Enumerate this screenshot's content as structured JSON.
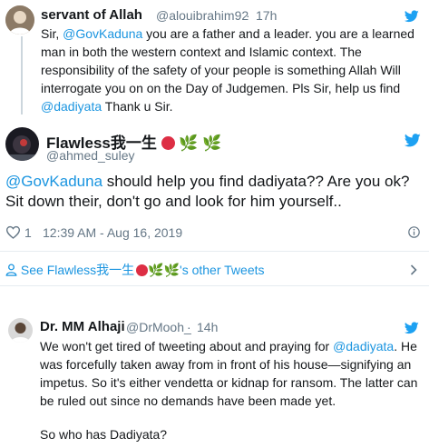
{
  "tweet1": {
    "name": "servant of Allah",
    "handle": "@alouibrahim92",
    "time": "17h",
    "text_pre": "Sir, ",
    "mention1": "@GovKaduna",
    "text_mid": " you are a father and a leader. you are a learned man in both the western context and Islamic context. The responsibility of the safety of your people is something Allah Will interrogate you on on the Day of Judgemen. Pls Sir, help us find ",
    "mention2": "@dadiyata",
    "text_post": " Thank u Sir."
  },
  "main_tweet": {
    "name": "Flawless我一生",
    "handle": "@ahmed_suley",
    "mention": "@GovKaduna",
    "text": " should help you find dadiyata?? Are you ok? Sit down their, don't go and look for him yourself..",
    "likes": "1",
    "timestamp": "12:39 AM - Aug 16, 2019"
  },
  "see_other": {
    "prefix": "See Flawless我一生",
    "suffix": "'s other Tweets"
  },
  "tweet3": {
    "name": "Dr. MM Alhaji",
    "handle": "@DrMooh_",
    "time": "14h",
    "text_pre": "We won't get tired of tweeting about and praying for ",
    "mention": "@dadiyata",
    "text_post": ". He was forcefully taken away from in front of his house—signifying an impetus. So it's either vendetta or kidnap for ransom. The latter can be ruled out since no demands have been made yet.",
    "text2": "So who has Dadiyata?"
  },
  "colors": {
    "accent": "#1da1f2",
    "link": "#1b95e0",
    "muted": "#657786",
    "red_circle": "#dd2e44"
  }
}
